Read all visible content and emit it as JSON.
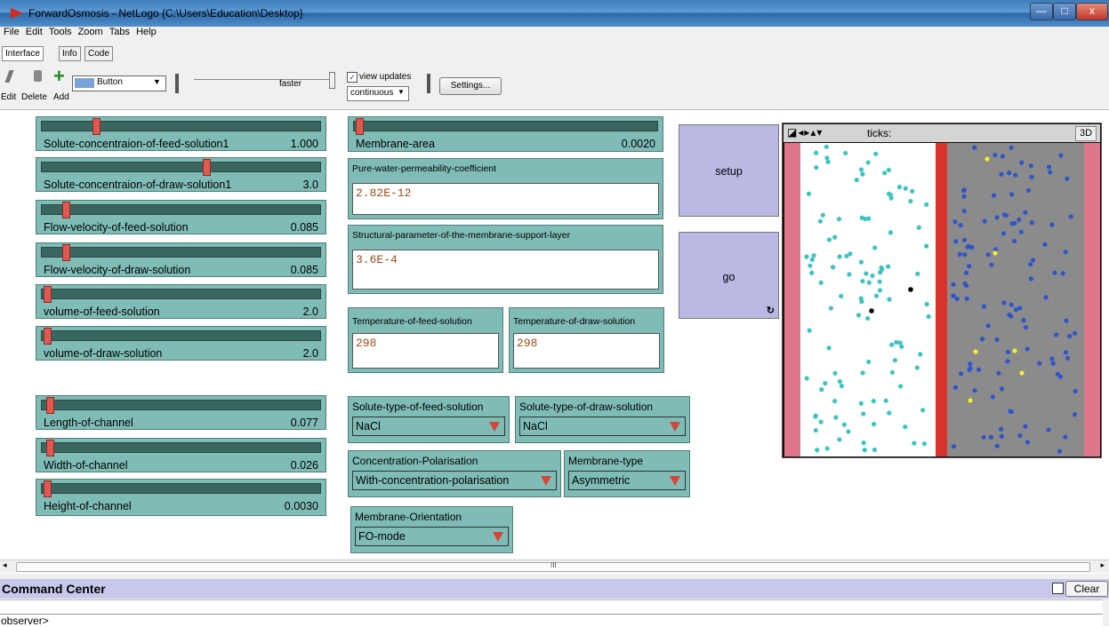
{
  "window": {
    "title": "ForwardOsmosis - NetLogo {C:\\Users\\Education\\Desktop}",
    "controls": {
      "minimize": "—",
      "maximize": "□",
      "close": "x"
    }
  },
  "menu": [
    "File",
    "Edit",
    "Tools",
    "Zoom",
    "Tabs",
    "Help"
  ],
  "tabs": [
    "Interface",
    "Info",
    "Code"
  ],
  "toolbar": {
    "edit_label": "Edit",
    "delete_label": "Delete",
    "add_label": "Add",
    "widget_type": "Button",
    "speed_label": "faster",
    "view_updates_label": "view updates",
    "update_mode": "continuous",
    "settings_label": "Settings..."
  },
  "sliders": [
    {
      "label": "Solute-concentraion-of-feed-solution1",
      "value": "1.000",
      "fraction": 0.18
    },
    {
      "label": "Solute-concentraion-of-draw-solution1",
      "value": "3.0",
      "fraction": 0.59
    },
    {
      "label": "Flow-velocity-of-feed-solution",
      "value": "0.085",
      "fraction": 0.07
    },
    {
      "label": "Flow-velocity-of-draw-solution",
      "value": "0.085",
      "fraction": 0.07
    },
    {
      "label": "volume-of-feed-solution",
      "value": "2.0",
      "fraction": 0.0
    },
    {
      "label": "volume-of-draw-solution",
      "value": "2.0",
      "fraction": 0.0
    },
    {
      "label": "Length-of-channel",
      "value": "0.077",
      "fraction": 0.01
    },
    {
      "label": "Width-of-channel",
      "value": "0.026",
      "fraction": 0.01
    },
    {
      "label": "Height-of-channel",
      "value": "0.0030",
      "fraction": 0.0
    },
    {
      "label": "Membrane-area",
      "value": "0.0020",
      "fraction": 0.0
    }
  ],
  "inputs": {
    "permeability": {
      "label": "Pure-water-permeability-coefficient",
      "value": "2.82E-12"
    },
    "structural": {
      "label": "Structural-parameter-of-the-membrane-support-layer",
      "value": "3.6E-4"
    },
    "temp_feed": {
      "label": "Temperature-of-feed-solution",
      "value": "298"
    },
    "temp_draw": {
      "label": "Temperature-of-draw-solution",
      "value": "298"
    }
  },
  "choosers": {
    "feed_type": {
      "label": "Solute-type-of-feed-solution",
      "value": "NaCl"
    },
    "draw_type": {
      "label": "Solute-type-of-draw-solution",
      "value": "NaCl"
    },
    "polarisation": {
      "label": "Concentration-Polarisation",
      "value": "With-concentration-polarisation"
    },
    "membrane_type": {
      "label": "Membrane-type",
      "value": "Asymmetric"
    },
    "orientation": {
      "label": "Membrane-Orientation",
      "value": "FO-mode"
    }
  },
  "buttons": {
    "setup": "setup",
    "go": "go",
    "go_forever_icon": "↻"
  },
  "view": {
    "ticks_label": "ticks:",
    "threed_label": "3D",
    "colors": {
      "feed_particle": "#3cc5c0",
      "draw_particle": "#2f55c8",
      "highlight": "#f4f02a",
      "membrane": "#d9342b",
      "draw_bg": "#8b8b8b",
      "edge": "#e0768a"
    }
  },
  "scrollbar": {
    "grip": "III"
  },
  "command_center": {
    "title": "Command Center",
    "clear_label": "Clear",
    "prompt": "observer>"
  }
}
